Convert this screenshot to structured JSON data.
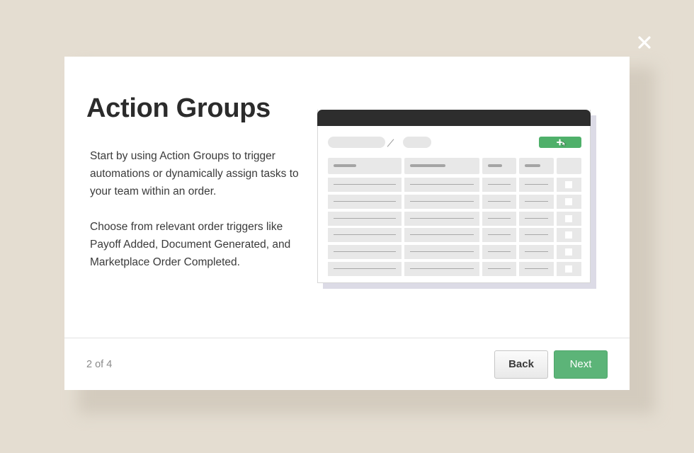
{
  "modal": {
    "title": "Action Groups",
    "description": [
      "Start by using Action Groups to trigger automations or dynamically assign tasks to your team within an order.",
      "Choose from relevant order triggers like Payoff Added, Document Generated, and Marketplace Order Completed."
    ],
    "step_counter": "2 of 4",
    "back_label": "Back",
    "next_label": "Next"
  },
  "icons": {
    "close": "close-icon",
    "add": "plus-icon",
    "cursor": "hand-pointer-icon"
  },
  "colors": {
    "backdrop": "#e4ddd1",
    "accent_green": "#5cb478",
    "title_text": "#2b2b2b"
  }
}
